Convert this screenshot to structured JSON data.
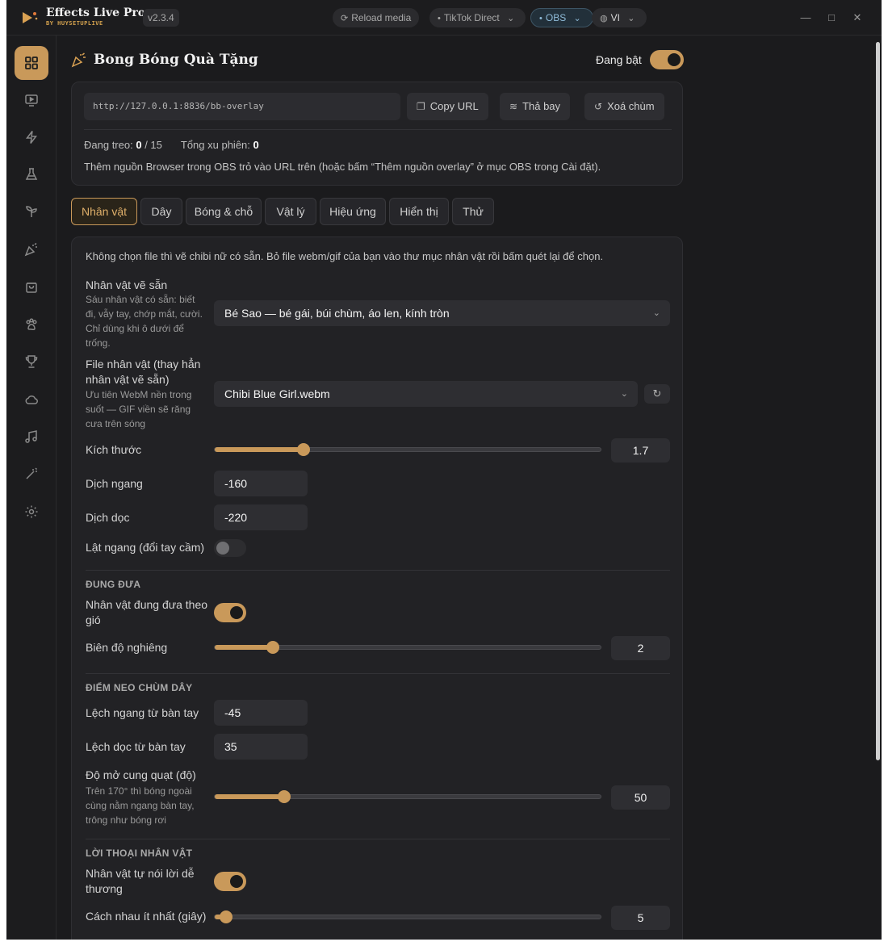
{
  "app": {
    "name": "Effects Live Pro",
    "sub": "BY HUYSETUPLIVE",
    "version": "v2.3.4",
    "chips": {
      "reload": "Reload media",
      "tiktok": "TikTok Direct",
      "obs": "OBS",
      "lang": "VI"
    }
  },
  "sidebar": {
    "items": [
      {
        "icon": "dashboard-icon"
      },
      {
        "icon": "monitor-play-icon"
      },
      {
        "icon": "lightning-icon"
      },
      {
        "icon": "flask-icon"
      },
      {
        "icon": "sprout-icon"
      },
      {
        "icon": "party-popper-icon"
      },
      {
        "icon": "shopping-bag-icon"
      },
      {
        "icon": "paw-icon"
      },
      {
        "icon": "trophy-icon"
      },
      {
        "icon": "cloud-icon"
      },
      {
        "icon": "music-icon"
      },
      {
        "icon": "magic-wand-icon"
      },
      {
        "icon": "gear-icon"
      }
    ]
  },
  "header": {
    "title": "Bong Bóng Quà Tặng",
    "enabled_label": "Đang bật",
    "enabled": true
  },
  "overlay": {
    "url": "http://127.0.0.1:8836/bb-overlay",
    "copy_label": "Copy URL",
    "release_label": "Thả bay",
    "clear_label": "Xoá chùm",
    "hanging_label": "Đang treo:",
    "hanging_value": "0",
    "hanging_sep": "/ 15",
    "total_label": "Tổng xu phiên:",
    "total_value": "0",
    "hint": "Thêm nguồn Browser trong OBS trỏ vào URL trên (hoặc bấm “Thêm nguồn overlay” ở mục OBS trong Cài đặt)."
  },
  "tabs": [
    "Nhân vật",
    "Dây",
    "Bóng & chỗ",
    "Vật lý",
    "Hiệu ứng",
    "Hiển thị",
    "Thử"
  ],
  "settings": {
    "intro": "Không chọn file thì vẽ chibi nữ có sẵn. Bỏ file webm/gif của bạn vào thư mục nhân vật rồi bấm quét lại để chọn.",
    "preset_label": "Nhân vật vẽ sẵn",
    "preset_desc": [
      "Sáu nhân vật có sẵn: biết",
      "đi, vẫy tay, chớp mắt, cười.",
      "Chỉ dùng khi ô dưới để",
      "trống."
    ],
    "preset_value": "Bé Sao — bé gái, búi chùm, áo len, kính tròn",
    "file_label": [
      "File nhân vật (thay hẳn",
      "nhân vật vẽ sẵn)"
    ],
    "file_desc": [
      "Ưu tiên WebM nền trong",
      "suốt — GIF viền sẽ răng",
      "cưa trên sóng"
    ],
    "file_value": "Chibi Blue Girl.webm",
    "size_label": "Kích thước",
    "size_value": "1.7",
    "size_fraction": 0.23,
    "shift_h_label": "Dịch ngang",
    "shift_h_value": "-160",
    "shift_v_label": "Dịch dọc",
    "shift_v_value": "-220",
    "flip_label": "Lật ngang (đổi tay cầm)",
    "flip_enabled": false,
    "sway_head": "ĐUNG ĐƯA",
    "sway_label": [
      "Nhân vật đung đưa theo",
      "gió"
    ],
    "sway_enabled": true,
    "tilt_label": "Biên độ nghiêng",
    "tilt_value": "2",
    "tilt_fraction": 0.15,
    "anchor_head": "ĐIỂM NEO CHÙM DÂY",
    "anchor_h_label": "Lệch ngang từ bàn tay",
    "anchor_h_value": "-45",
    "anchor_v_label": "Lệch dọc từ bàn tay",
    "anchor_v_value": "35",
    "fan_label": "Độ mở cung quạt (độ)",
    "fan_desc": [
      "Trên 170° thì bóng ngoài",
      "cùng nằm ngang bàn tay,",
      "trông như bóng rơi"
    ],
    "fan_value": "50",
    "fan_fraction": 0.18,
    "speech_head": "LỜI THOẠI NHÂN VẬT",
    "speech_label": [
      "Nhân vật tự nói lời dễ",
      "thương"
    ],
    "speech_enabled": true,
    "gap_label": "Cách nhau ít nhất (giây)",
    "gap_value": "5",
    "gap_fraction": 0.03
  },
  "colors": {
    "accent": "#c9995a",
    "background": "#1b1b1d",
    "card": "#222225"
  }
}
